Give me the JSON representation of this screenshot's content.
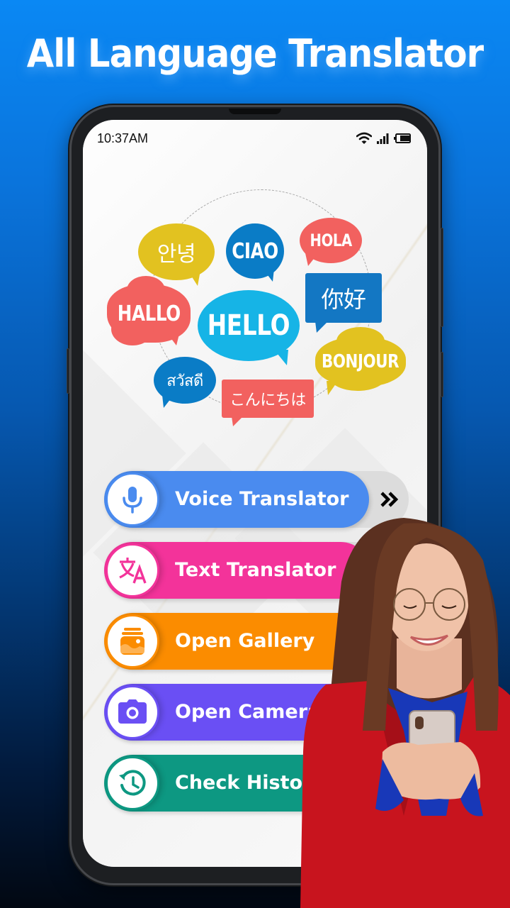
{
  "headline": "All Language Translator",
  "status_bar": {
    "time": "10:37AM",
    "icons": [
      "wifi-icon",
      "signal-icon",
      "battery-icon"
    ]
  },
  "greeting_bubbles": [
    {
      "text": "안녕",
      "language": "Korean",
      "color": "#e2c220"
    },
    {
      "text": "CIAO",
      "language": "Italian",
      "color": "#0a7cc6"
    },
    {
      "text": "HOLA",
      "language": "Spanish",
      "color": "#f2615f"
    },
    {
      "text": "你好",
      "language": "Chinese",
      "color": "#1377c3"
    },
    {
      "text": "HALLO",
      "language": "German",
      "color": "#f2615f"
    },
    {
      "text": "HELLO",
      "language": "English",
      "color": "#16b4e6"
    },
    {
      "text": "BONJOUR",
      "language": "French",
      "color": "#e2c220"
    },
    {
      "text": "สวัสดี",
      "language": "Thai",
      "color": "#0a7cc6"
    },
    {
      "text": "こんにちは",
      "language": "Japanese",
      "color": "#f2615f"
    }
  ],
  "menu": [
    {
      "label": "Voice Translator",
      "icon": "microphone-icon",
      "color": "#4a8bef"
    },
    {
      "label": "Text Translator",
      "icon": "translate-icon",
      "color": "#f3339a"
    },
    {
      "label": "Open Gallery",
      "icon": "gallery-icon",
      "color": "#fb8c00"
    },
    {
      "label": "Open Camera",
      "icon": "camera-icon",
      "color": "#6a4ff4"
    },
    {
      "label": "Check History",
      "icon": "history-icon",
      "color": "#0d9882"
    }
  ],
  "arrow_icon": "double-chevron-right-icon",
  "colors": {
    "background_top": "#0a88f4",
    "background_bottom": "#020812",
    "phone_frame": "#1d1f22"
  }
}
